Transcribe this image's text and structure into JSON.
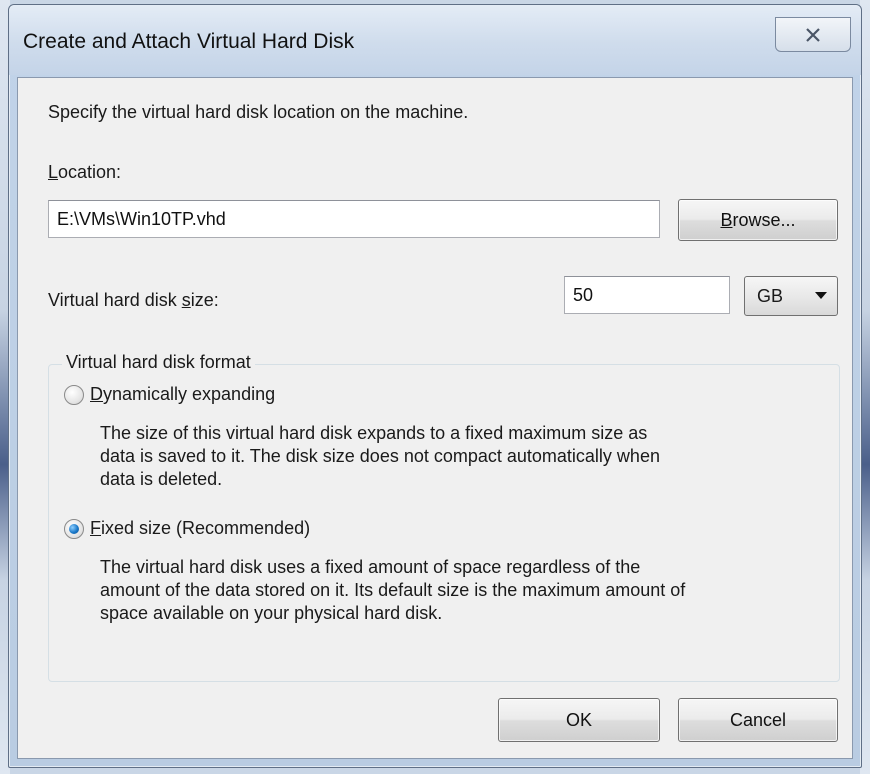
{
  "window": {
    "title": "Create and Attach Virtual Hard Disk"
  },
  "dialog": {
    "instruction": "Specify the virtual hard disk location on the machine.",
    "location": {
      "label_accel": "L",
      "label_rest": "ocation:",
      "value": "E:\\VMs\\Win10TP.vhd",
      "browse_accel": "B",
      "browse_rest": "rowse..."
    },
    "size": {
      "label_pre": "Virtual hard disk ",
      "label_accel": "s",
      "label_post": "ize:",
      "value": "50",
      "unit": "GB"
    },
    "format": {
      "group_title": "Virtual hard disk format",
      "dynamic": {
        "label_accel": "D",
        "label_rest": "ynamically expanding",
        "checked": false,
        "description_lines": [
          "The size of this virtual hard disk expands to a fixed maximum size as",
          "data is saved to it.  The disk size does not compact automatically when",
          "data is deleted."
        ]
      },
      "fixed": {
        "label_accel": "F",
        "label_rest": "ixed size (Recommended)",
        "checked": true,
        "description_lines": [
          "The virtual hard disk uses a fixed amount of space regardless of the",
          "amount of the data stored on it.  Its default size is the maximum amount of",
          "space available on your physical hard disk."
        ]
      }
    },
    "buttons": {
      "ok": "OK",
      "cancel": "Cancel"
    }
  },
  "icons": {
    "close": "close-icon",
    "dropdown": "chevron-down-icon"
  },
  "colors": {
    "radio_selected": "#1a78c9",
    "titlebar": "#cfdcec"
  }
}
